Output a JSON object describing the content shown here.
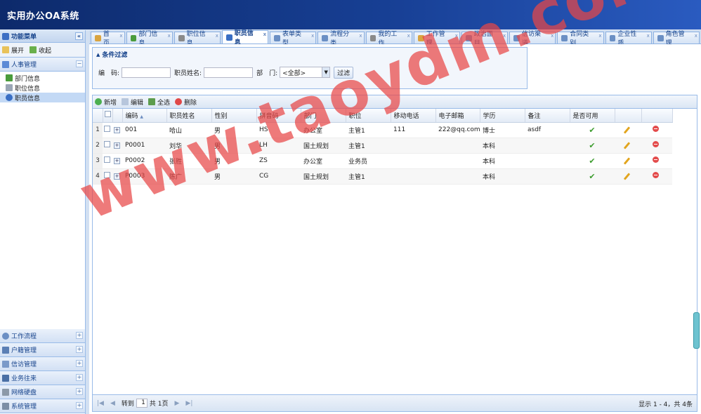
{
  "app": {
    "title": "实用办公OA系统"
  },
  "sidebar": {
    "header": "功能菜单",
    "collapse_icon": "«",
    "expand_label": "展开",
    "collapse_label": "收起",
    "group_open": "人事管理",
    "group_open_toggle": "−",
    "tree": [
      {
        "label": "部门信息",
        "icon": "tree-icon"
      },
      {
        "label": "职位信息",
        "icon": "list-icon"
      },
      {
        "label": "职员信息",
        "icon": "user-icon",
        "selected": true
      }
    ],
    "groups": [
      {
        "label": "工作流程",
        "toggle": "+"
      },
      {
        "label": "户籍管理",
        "toggle": "+"
      },
      {
        "label": "信访管理",
        "toggle": "+"
      },
      {
        "label": "业务往来",
        "toggle": "+"
      },
      {
        "label": "网络硬盘",
        "toggle": "+"
      },
      {
        "label": "系统管理",
        "toggle": "+"
      }
    ]
  },
  "tabs": [
    {
      "label": "首页",
      "active": false,
      "color": "#d9a441"
    },
    {
      "label": "部门信息",
      "active": false,
      "color": "#4a9c3c"
    },
    {
      "label": "职位信息",
      "active": false,
      "color": "#8a8a8a"
    },
    {
      "label": "职员信息",
      "active": true,
      "color": "#3a6fc4"
    },
    {
      "label": "表单类型",
      "active": false,
      "color": "#6b8fc4"
    },
    {
      "label": "流程分类",
      "active": false,
      "color": "#6b8fc4"
    },
    {
      "label": "我的工作",
      "active": false,
      "color": "#8a8a8a"
    },
    {
      "label": "工作管理",
      "active": false,
      "color": "#d9a441"
    },
    {
      "label": "政治面目",
      "active": false,
      "color": "#6b8fc4"
    },
    {
      "label": "信访渠道",
      "active": false,
      "color": "#6b8fc4"
    },
    {
      "label": "合同类别",
      "active": false,
      "color": "#6b8fc4"
    },
    {
      "label": "企业性质",
      "active": false,
      "color": "#6b8fc4"
    },
    {
      "label": "角色管理",
      "active": false,
      "color": "#6b8fc4"
    }
  ],
  "tab_close": "x",
  "filter": {
    "legend": "条件过滤",
    "code_label": "编　码:",
    "code_value": "",
    "name_label": "职员姓名:",
    "name_value": "",
    "dept_label": "部　门:",
    "dept_value": "<全部>",
    "dept_arrow": "▼",
    "filter_button": "过滤"
  },
  "grid_toolbar": {
    "add": "新增",
    "edit": "编辑",
    "select_all": "全选",
    "delete": "删除"
  },
  "columns": [
    "编码",
    "职员姓名",
    "性别",
    "拼音码",
    "部门",
    "职位",
    "移动电话",
    "电子邮箱",
    "学历",
    "备注",
    "是否可用"
  ],
  "sort_indicator": "▲",
  "expand_glyph": "+",
  "enabled_glyph": "✔",
  "rows": [
    {
      "n": "1",
      "code": "001",
      "name": "哈山",
      "gender": "男",
      "pinyin": "HS",
      "dept": "办公室",
      "position": "主管1",
      "mobile": "111",
      "email": "222@qq.com",
      "education": "博士",
      "remark": "asdf"
    },
    {
      "n": "2",
      "code": "P0001",
      "name": "刘华",
      "gender": "男",
      "pinyin": "LH",
      "dept": "国土规划",
      "position": "主管1",
      "mobile": "",
      "email": "",
      "education": "本科",
      "remark": ""
    },
    {
      "n": "3",
      "code": "P0002",
      "name": "张胜",
      "gender": "男",
      "pinyin": "ZS",
      "dept": "办公室",
      "position": "业务员",
      "mobile": "",
      "email": "",
      "education": "本科",
      "remark": ""
    },
    {
      "n": "4",
      "code": "P0003",
      "name": "陈广",
      "gender": "男",
      "pinyin": "CG",
      "dept": "国土规划",
      "position": "主管1",
      "mobile": "",
      "email": "",
      "education": "本科",
      "remark": ""
    }
  ],
  "pager": {
    "first": "|◀",
    "prev": "◀",
    "goto_label": "转到",
    "page_value": "1",
    "total_pages": "共 1页",
    "next": "▶",
    "last": "▶|",
    "summary": "显示 1 - 4，共 4条"
  },
  "watermark": "www.taoydm.com",
  "colors": {
    "header_bg": "#173f94",
    "panel_border": "#99bbe8",
    "watermark": "#e84646"
  }
}
